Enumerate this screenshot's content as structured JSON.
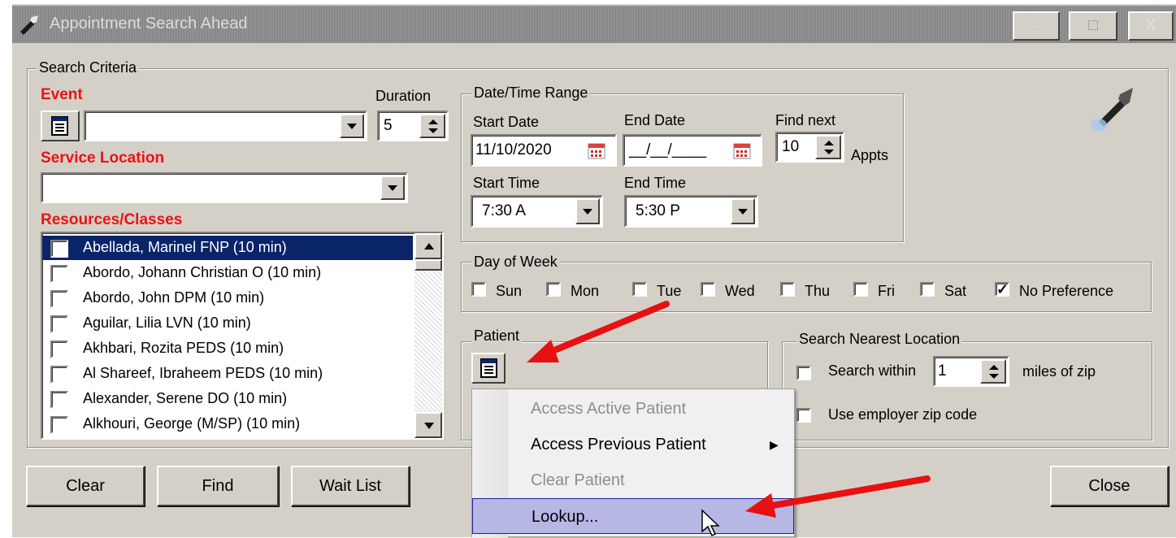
{
  "window": {
    "title": "Appointment Search Ahead",
    "min_label": "_",
    "max_label": "□",
    "close_label": "X"
  },
  "search_criteria": {
    "group_label": "Search Criteria",
    "event": {
      "label": "Event",
      "value": ""
    },
    "duration": {
      "label": "Duration",
      "value": "5"
    },
    "service_location": {
      "label": "Service Location",
      "value": ""
    },
    "resources": {
      "label": "Resources/Classes",
      "items": [
        {
          "label": "Abellada, Marinel FNP (10 min)",
          "checked": false,
          "selected": true
        },
        {
          "label": "Abordo, Johann Christian O (10 min)",
          "checked": false
        },
        {
          "label": "Abordo, John DPM (10 min)",
          "checked": false
        },
        {
          "label": "Aguilar, Lilia LVN (10 min)",
          "checked": false
        },
        {
          "label": "Akhbari, Rozita PEDS (10 min)",
          "checked": false
        },
        {
          "label": "Al Shareef, Ibraheem PEDS (10 min)",
          "checked": false
        },
        {
          "label": "Alexander, Serene DO (10 min)",
          "checked": false
        },
        {
          "label": "Alkhouri, George (M/SP) (10 min)",
          "checked": false
        }
      ]
    },
    "datetime": {
      "group_label": "Date/Time Range",
      "start_date_label": "Start Date",
      "start_date": "11/10/2020",
      "end_date_label": "End Date",
      "end_date": "__/__/____",
      "find_next_label": "Find next",
      "find_next": "10",
      "appts_label": "Appts",
      "start_time_label": "Start Time",
      "start_time": "7:30 A",
      "end_time_label": "End Time",
      "end_time": "5:30 P"
    },
    "day_of_week": {
      "group_label": "Day of Week",
      "days": [
        {
          "label": "Sun",
          "checked": false
        },
        {
          "label": "Mon",
          "checked": false
        },
        {
          "label": "Tue",
          "checked": false
        },
        {
          "label": "Wed",
          "checked": false
        },
        {
          "label": "Thu",
          "checked": false
        },
        {
          "label": "Fri",
          "checked": false
        },
        {
          "label": "Sat",
          "checked": false
        },
        {
          "label": "No Preference",
          "checked": true
        }
      ]
    },
    "patient": {
      "group_label": "Patient"
    },
    "nearest": {
      "group_label": "Search Nearest Location",
      "search_within_label": "Search within",
      "search_within_value": "1",
      "miles_label": "miles of zip",
      "employer_label": "Use employer zip code"
    }
  },
  "context_menu": {
    "items": [
      {
        "label": "Access Active Patient",
        "disabled": true
      },
      {
        "label": "Access Previous Patient",
        "disabled": false,
        "submenu": true
      },
      {
        "label": "Clear Patient",
        "disabled": true
      },
      {
        "label": "Lookup...",
        "disabled": false,
        "highlighted": true
      }
    ]
  },
  "buttons": {
    "clear": "Clear",
    "find": "Find",
    "wait_list": "Wait List",
    "close": "Close"
  },
  "colors": {
    "required_label": "#ee1111",
    "selection": "#0a246a",
    "arrow": "#e81010",
    "menu_highlight": "#b7b7e6"
  }
}
